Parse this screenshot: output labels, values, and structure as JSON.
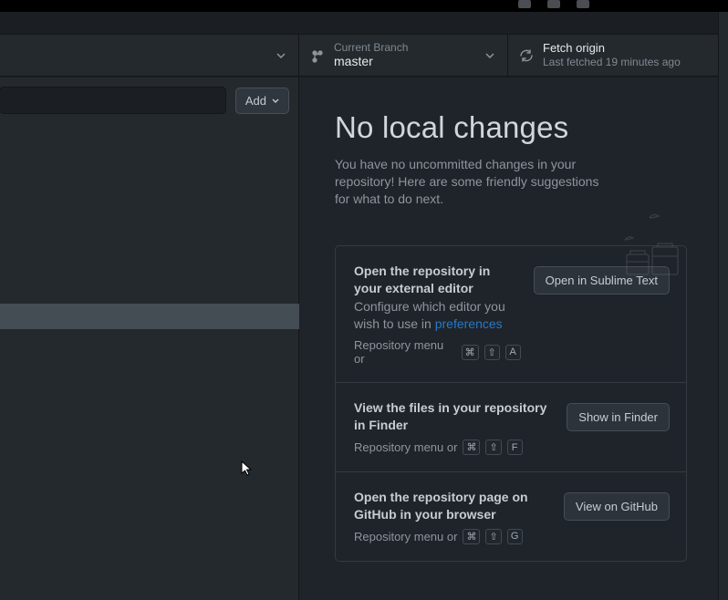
{
  "toolbar": {
    "branch_label": "Current Branch",
    "branch_value": "master",
    "fetch_label": "Fetch origin",
    "fetch_sub": "Last fetched 19 minutes ago",
    "add_label": "Add"
  },
  "main": {
    "heading": "No local changes",
    "description": "You have no uncommitted changes in your repository! Here are some friendly suggestions for what to do next."
  },
  "cards": [
    {
      "title": "Open the repository in your external editor",
      "sub_prefix": "Configure which editor you wish to use in ",
      "sub_link": "preferences",
      "hint_prefix": "Repository menu or",
      "keys": [
        "⌘",
        "⇧",
        "A"
      ],
      "button": "Open in Sublime Text"
    },
    {
      "title": "View the files in your repository in Finder",
      "sub_prefix": "",
      "sub_link": "",
      "hint_prefix": "Repository menu or",
      "keys": [
        "⌘",
        "⇧",
        "F"
      ],
      "button": "Show in Finder"
    },
    {
      "title": "Open the repository page on GitHub in your browser",
      "sub_prefix": "",
      "sub_link": "",
      "hint_prefix": "Repository menu or",
      "keys": [
        "⌘",
        "⇧",
        "G"
      ],
      "button": "View on GitHub"
    }
  ]
}
